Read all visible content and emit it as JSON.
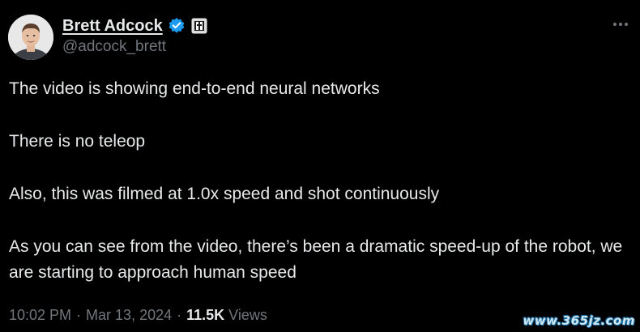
{
  "author": {
    "display_name": "Brett Adcock",
    "handle": "@adcock_brett",
    "verified_icon": "verified-badge-icon",
    "affiliate_icon": "company-affiliate-icon"
  },
  "more_icon": "more-horizontal-icon",
  "tweet": {
    "paragraphs": [
      "The video is showing end-to-end neural networks",
      "There is no teleop",
      "Also, this was filmed at 1.0x speed and shot continuously",
      "As you can see from the video, there’s been a dramatic speed-up of the robot, we are starting to approach human speed"
    ]
  },
  "meta": {
    "time": "10:02 PM",
    "separator": "·",
    "date": "Mar 13, 2024",
    "views_count": "11.5K",
    "views_label": "Views"
  },
  "watermark": "www.365jz.com",
  "colors": {
    "background": "#000000",
    "text_primary": "#e7e9ea",
    "text_secondary": "#71767b",
    "verified_blue": "#1d9bf0"
  }
}
